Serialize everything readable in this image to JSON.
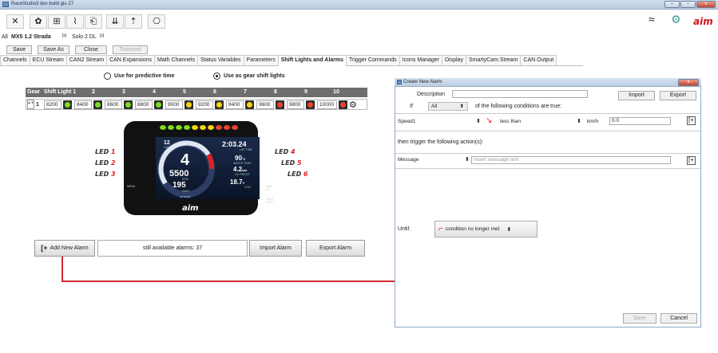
{
  "window": {
    "title": "RaceStudio3 dev  build giu 27",
    "min": "‒",
    "max": "▫",
    "close": "x"
  },
  "toolbar": {
    "icons": [
      "wrench-icon",
      "gear-flower-icon",
      "grid-icon",
      "chart-icon",
      "export-icon",
      "download-icon",
      "plug-icon",
      "ruler-icon"
    ],
    "wifi": "≈",
    "settings": "⚙",
    "logo": "aim"
  },
  "config": {
    "all": "All",
    "active": "MX5 1.2 Strada",
    "active_mark": "[x]",
    "other": "Solo 2 DL",
    "other_mark": "[x]"
  },
  "buttons": {
    "save": "Save",
    "save_as": "Save As",
    "close": "Close",
    "transmit": "Transmit"
  },
  "tabs": [
    "Channels",
    "ECU Stream",
    "CAN2 Stream",
    "CAN Expansions",
    "Math Channels",
    "Status Variables",
    "Parameters",
    "Shift Lights and Alarms",
    "Trigger Commands",
    "Icons Manager",
    "Display",
    "SmartyCam Stream",
    "CAN Output"
  ],
  "active_tab": "Shift Lights and Alarms",
  "radios": {
    "predictive": "Use for predictive time",
    "gear_shift": "Use as gear shift lights"
  },
  "shift": {
    "headers": [
      "Gear",
      "Shift Light 1",
      "2",
      "3",
      "4",
      "5",
      "6",
      "7",
      "8",
      "9",
      "10"
    ],
    "gear": "1",
    "values": [
      "8200",
      "8400",
      "8600",
      "8800",
      "9000",
      "9200",
      "9400",
      "9600",
      "9800",
      "10000"
    ],
    "colors": [
      "#7ddc1f",
      "#7ddc1f",
      "#7ddc1f",
      "#7ddc1f",
      "#f5d40f",
      "#f5d40f",
      "#f5d40f",
      "#e8452a",
      "#e8452a",
      "#e8452a"
    ],
    "stepper": "▲▼",
    "gear_icon": "⚙"
  },
  "dashboard": {
    "led_left": [
      "LED 1",
      "LED 2",
      "LED 3"
    ],
    "led_right": [
      "LED 4",
      "LED 5",
      "LED 6"
    ],
    "gear": "4",
    "laptime": "2:03.24",
    "laptime_label": "LAP TIME",
    "rpm": "5500",
    "rpm_label": "RPM",
    "speed": "195",
    "speed_label": "KM/H",
    "water": "90",
    "water_unit": "°C",
    "water_label": "WATER TEMP",
    "oil": "4.2",
    "oil_unit": "bar",
    "oil_label": "OIL PRESS",
    "volt": "18.7",
    "volt_unit": "V",
    "volt_label": "VOLT",
    "top_num": "12",
    "top_label": "LAP",
    "brand": "aim",
    "left_btn": "MENU",
    "right_btn1": "MEM OK",
    "right_btn2": "VIEW SHIFT",
    "bottom_label": "OPTIONS"
  },
  "alarms": {
    "add": "Add New Alarm",
    "available": "still available alarms: 37",
    "import": "Import Alarm",
    "export": "Export Alarm"
  },
  "dialog": {
    "title": "Create New Alarm",
    "description_label": "Description",
    "description_value": "",
    "import": "Import",
    "export": "Export",
    "if_label": "If",
    "if_mode": "All",
    "if_text": "of the following conditions are true:",
    "cond_channel": "Speed1",
    "cond_operator": "less than",
    "cond_unit": "km/h",
    "cond_value": "0.0",
    "then_text": "then trigger the following action(s):",
    "action_type": "Message",
    "action_placeholder": "insert message text",
    "until_label": "Until:",
    "until_value": "condition no longer met",
    "save": "Save",
    "cancel": "Cancel",
    "close": "x"
  }
}
